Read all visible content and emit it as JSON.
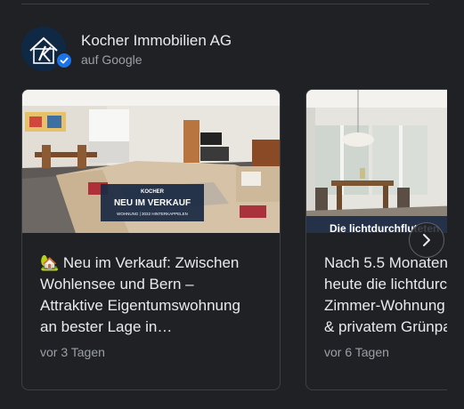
{
  "source": {
    "name": "Kocher Immobilien AG",
    "platform": "auf Google"
  },
  "posts": [
    {
      "text": "🏡 Neu im Verkauf: Zwischen\nWohlensee und Bern –\nAttraktive Eigentumswohnung\nan bester Lage in…",
      "time": "vor 3 Tagen",
      "image_overlay": {
        "brand": "KOCHER",
        "headline": "NEU IM VERKAUF",
        "subline": "WOHNUNG | 3032 HINTERKAPPELEN"
      }
    },
    {
      "text": "Nach 5.5 Monaten\nheute die lichtdurch\nZimmer-Wohnung\n& privatem Grünpa",
      "time": "vor 6 Tagen",
      "image_overlay": {
        "headline": "Die lichtdurchfluteten"
      }
    }
  ],
  "icons": {
    "verified": "verified-check-icon",
    "next": "chevron-right-icon"
  },
  "colors": {
    "background": "#202124",
    "border": "#3c4043",
    "text": "#e8eaed",
    "muted": "#9aa0a6",
    "verified": "#1a73e8",
    "overlay_navy": "#1c2a44"
  }
}
